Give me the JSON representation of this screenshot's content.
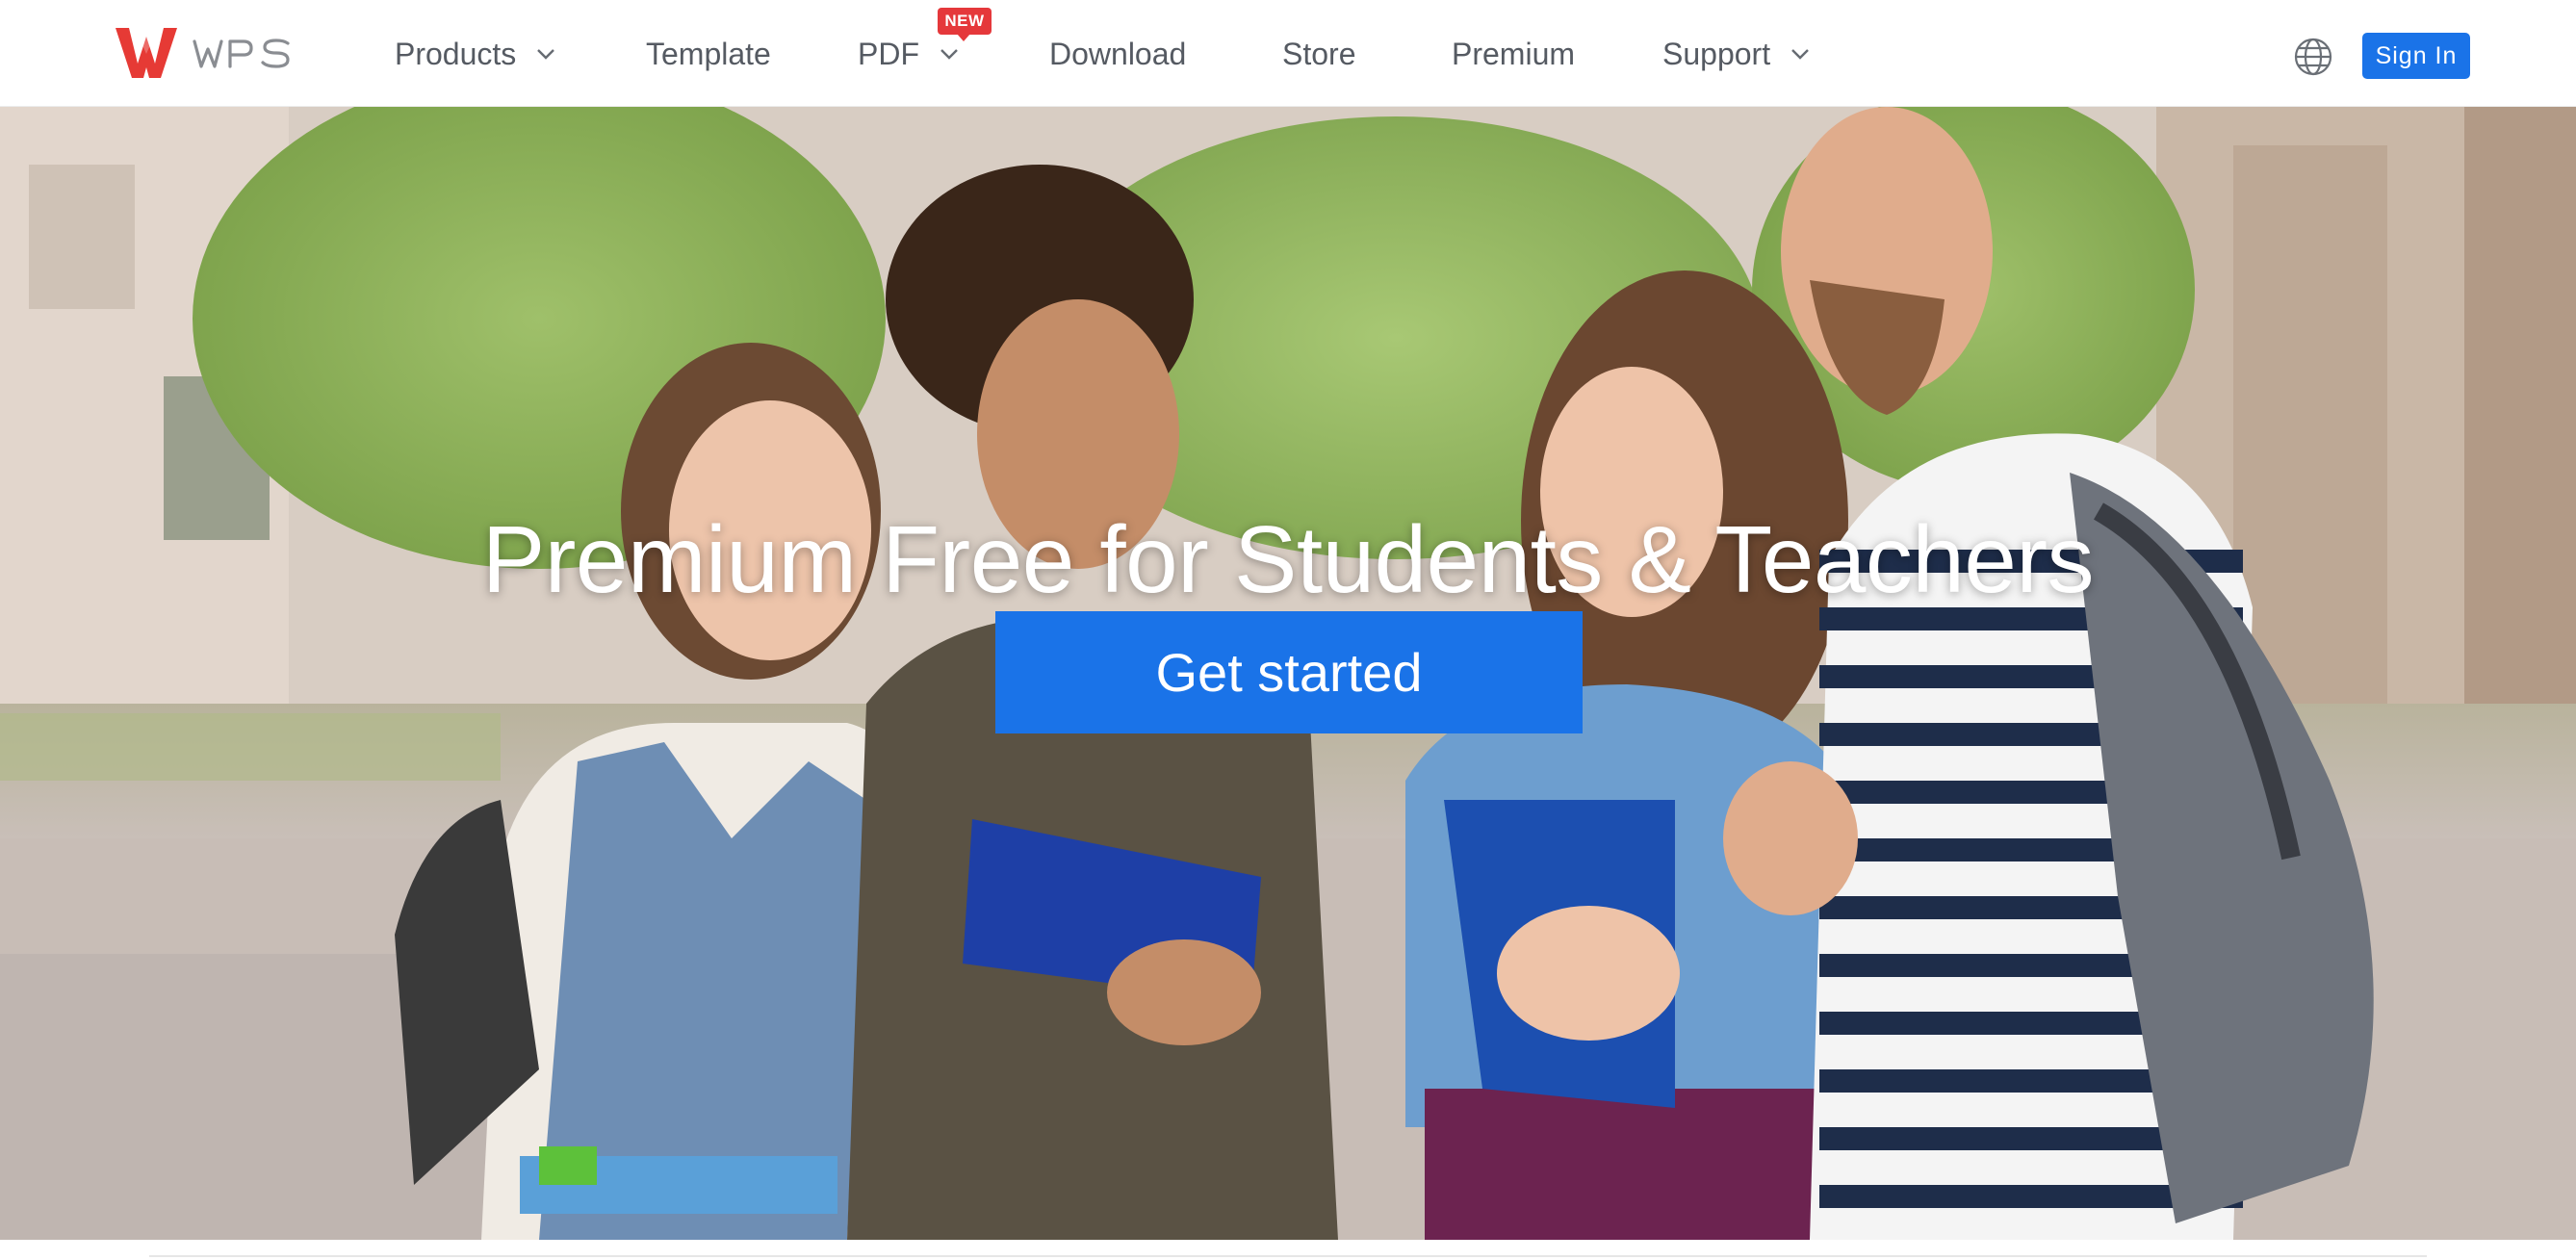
{
  "header": {
    "brand_name": "WPS",
    "nav": {
      "products": "Products",
      "template": "Template",
      "pdf": "PDF",
      "pdf_badge": "NEW",
      "download": "Download",
      "store": "Store",
      "premium": "Premium",
      "support": "Support"
    },
    "language_icon": "globe-icon",
    "sign_in": "Sign In"
  },
  "hero": {
    "title": "Premium Free for Students & Teachers",
    "cta": "Get started",
    "image": "photo of four smiling students holding books outdoors"
  },
  "colors": {
    "brand_red": "#e63a35",
    "accent_blue": "#1a73e8",
    "nav_text": "#555a62",
    "badge_red": "#e5383b",
    "white": "#ffffff"
  }
}
